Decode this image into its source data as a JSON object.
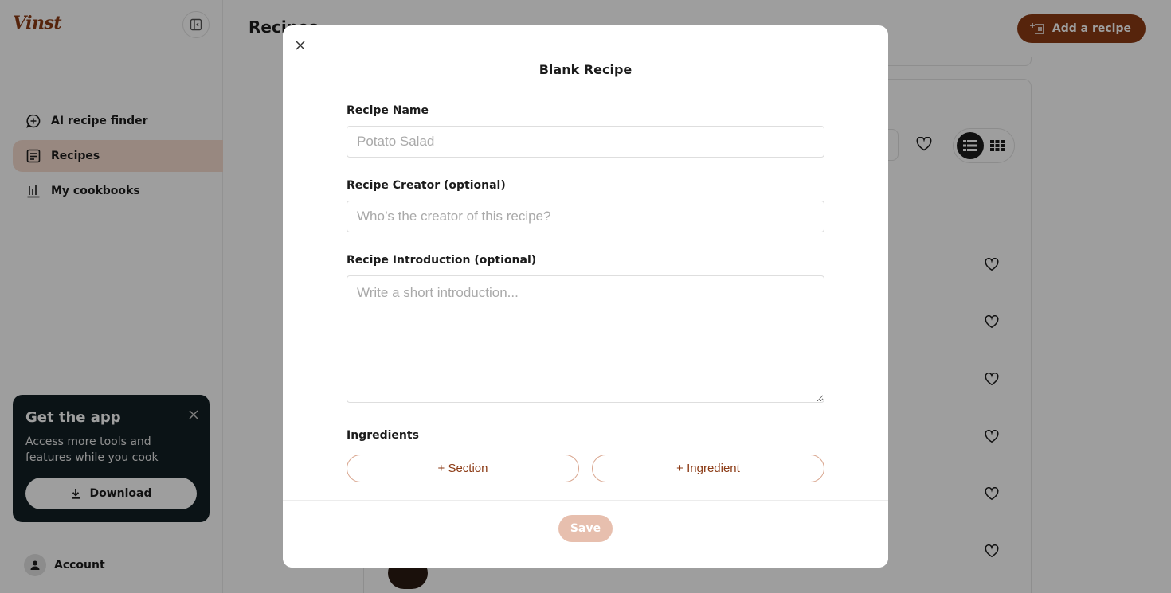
{
  "app": {
    "logo": "Vinst"
  },
  "sidebar": {
    "items": [
      {
        "label": "AI recipe finder",
        "icon": "chat-sparkle-icon",
        "active": false
      },
      {
        "label": "Recipes",
        "icon": "recipe-list-icon",
        "active": true
      },
      {
        "label": "My cookbooks",
        "icon": "bar-chart-icon",
        "active": false
      }
    ],
    "promo": {
      "title": "Get the app",
      "text": "Access more tools and features while you cook",
      "download_label": "Download"
    },
    "account_label": "Account"
  },
  "main": {
    "page_title": "Recipes",
    "add_recipe_label": "Add a recipe"
  },
  "modal": {
    "title": "Blank Recipe",
    "fields": {
      "name": {
        "label": "Recipe Name",
        "placeholder": "Potato Salad",
        "value": ""
      },
      "creator": {
        "label": "Recipe Creator (optional)",
        "placeholder": "Who’s the creator of this recipe?",
        "value": ""
      },
      "intro": {
        "label": "Recipe Introduction (optional)",
        "placeholder": "Write a short introduction...",
        "value": ""
      }
    },
    "ingredients": {
      "label": "Ingredients",
      "section_button": "+ Section",
      "ingredient_button": "+ Ingredient"
    },
    "save_label": "Save"
  },
  "colors": {
    "accent": "#8b3a14",
    "accent_light": "#f5dbcf",
    "save_disabled": "#e7bfae",
    "promo_bg": "#132025"
  }
}
